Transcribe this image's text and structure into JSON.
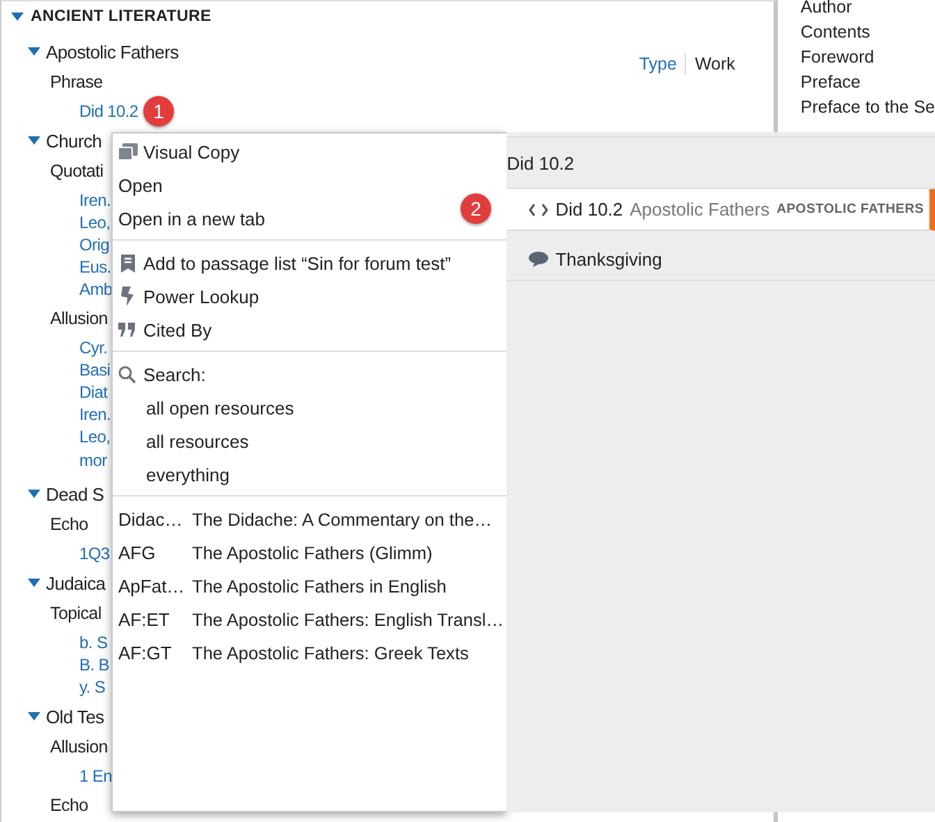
{
  "tree": {
    "heading": "ANCIENT LITERATURE",
    "expanded": true,
    "children": [
      {
        "kind": "group",
        "label": "Apostolic Fathers",
        "expanded": true,
        "children": [
          {
            "kind": "section",
            "label": "Phrase",
            "children": [
              {
                "kind": "ref",
                "label": "Did 10.2"
              }
            ]
          }
        ]
      },
      {
        "kind": "group",
        "label": "Church",
        "expanded": true,
        "children": [
          {
            "kind": "section",
            "label": "Quotati",
            "children": [
              {
                "kind": "ref",
                "label": "Iren."
              },
              {
                "kind": "ref",
                "label": "Leo,"
              },
              {
                "kind": "ref",
                "label": "Orig"
              },
              {
                "kind": "ref",
                "label": "Eus."
              },
              {
                "kind": "ref",
                "label": "Amb"
              }
            ]
          },
          {
            "kind": "section",
            "label": "Allusion",
            "children": [
              {
                "kind": "ref",
                "label": "Cyr."
              },
              {
                "kind": "ref",
                "label": "Basi"
              },
              {
                "kind": "ref",
                "label": "Diat"
              },
              {
                "kind": "ref",
                "label": "Iren."
              },
              {
                "kind": "ref",
                "label": "Leo,"
              },
              {
                "kind": "more",
                "label": "mor"
              }
            ]
          }
        ]
      },
      {
        "kind": "group",
        "label": "Dead S",
        "expanded": true,
        "children": [
          {
            "kind": "section",
            "label": "Echo",
            "children": [
              {
                "kind": "ref",
                "label": "1Q3"
              }
            ]
          }
        ]
      },
      {
        "kind": "group",
        "label": "Judaica",
        "expanded": true,
        "children": [
          {
            "kind": "section",
            "label": "Topical",
            "children": [
              {
                "kind": "ref",
                "label": "b. S"
              },
              {
                "kind": "ref",
                "label": "B. B"
              },
              {
                "kind": "ref",
                "label": "y. S"
              }
            ]
          }
        ]
      },
      {
        "kind": "group",
        "label": "Old Tes",
        "expanded": true,
        "children": [
          {
            "kind": "section",
            "label": "Allusion",
            "children": [
              {
                "kind": "ref",
                "label": "1 En"
              }
            ]
          },
          {
            "kind": "section",
            "label": "Echo"
          }
        ]
      }
    ]
  },
  "view_toggle": [
    {
      "label": "Type",
      "selected": false
    },
    {
      "label": "Work",
      "selected": true
    }
  ],
  "toc": [
    {
      "label": "Author"
    },
    {
      "label": "Contents"
    },
    {
      "label": "Foreword"
    },
    {
      "label": "Preface"
    },
    {
      "label": "Preface to the Se"
    }
  ],
  "context_menu": {
    "sections": [
      [
        {
          "kind": "copy",
          "label": "Visual Copy"
        },
        {
          "kind": "open",
          "label": "Open"
        },
        {
          "kind": "open",
          "label": "Open in a new tab"
        }
      ],
      [
        {
          "kind": "list",
          "label": "Add to passage list “Sin for forum test”"
        },
        {
          "kind": "lookup",
          "label": "Power Lookup"
        },
        {
          "kind": "citation",
          "label": "Cited By"
        }
      ],
      [
        {
          "kind": "search",
          "label": "Search:"
        },
        {
          "kind": "scope",
          "label": "all open resources"
        },
        {
          "kind": "scope",
          "label": "all resources"
        },
        {
          "kind": "scope",
          "label": "everything"
        }
      ],
      [
        {
          "kind": "resource",
          "abbrev": "Didac…",
          "title": "The Didache: A Commentary on the…"
        },
        {
          "kind": "resource",
          "abbrev": "AFG",
          "title": "The Apostolic Fathers (Glimm)"
        },
        {
          "kind": "resource",
          "abbrev": "ApFat…",
          "title": "The Apostolic Fathers in English"
        },
        {
          "kind": "resource",
          "abbrev": "AF:ET",
          "title": "The Apostolic Fathers: English Transl…"
        },
        {
          "kind": "resource",
          "abbrev": "AF:GT",
          "title": "The Apostolic Fathers: Greek Texts"
        }
      ]
    ]
  },
  "preview": {
    "title": "Did 10.2",
    "results": [
      {
        "kind": "reference",
        "reference": "Did 10.2",
        "work": "Apostolic Fathers",
        "category": "APOSTOLIC FATHERS",
        "selected": true
      },
      {
        "kind": "topic",
        "label": "Thanksgiving",
        "selected": false
      }
    ]
  },
  "badges": [
    "1",
    "2"
  ]
}
